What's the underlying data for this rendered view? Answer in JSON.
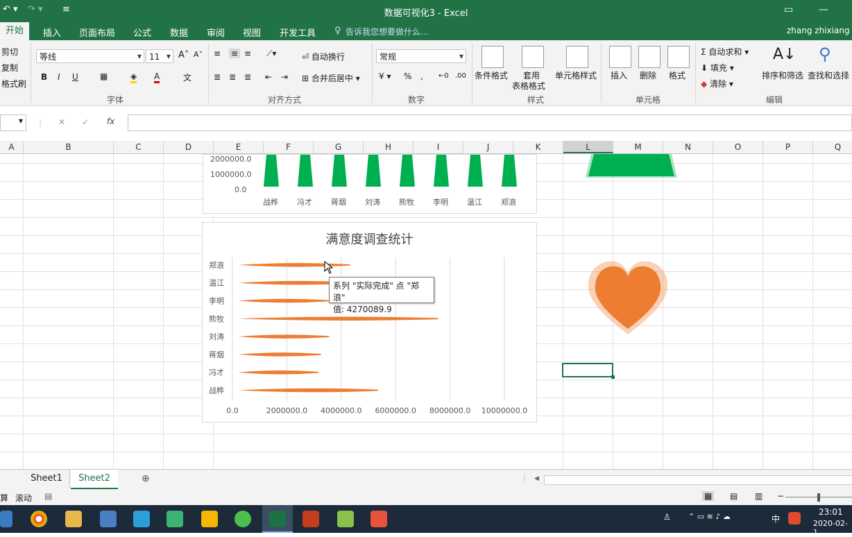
{
  "window": {
    "title": "数据可视化3 - Excel",
    "user": "zhang zhixiang"
  },
  "tabs": [
    "开始",
    "插入",
    "页面布局",
    "公式",
    "数据",
    "审阅",
    "视图",
    "开发工具"
  ],
  "tell_me": "告诉我您想要做什么...",
  "ribbon": {
    "clipboard": {
      "cut": "剪切",
      "copy": "复制",
      "painter": "格式刷"
    },
    "font": {
      "name": "等线",
      "size": "11",
      "group": "字体",
      "bold": "B",
      "italic": "I",
      "underline": "U"
    },
    "align": {
      "wrap": "自动换行",
      "merge": "合并后居中",
      "group": "对齐方式"
    },
    "number": {
      "format": "常规",
      "group": "数字"
    },
    "styles": {
      "cond": "条件格式",
      "table1": "套用",
      "table2": "表格格式",
      "cell": "单元格样式",
      "group": "样式"
    },
    "cells": {
      "insert": "插入",
      "delete": "删除",
      "format": "格式",
      "group": "单元格"
    },
    "edit": {
      "autosum": "自动求和",
      "fill": "填充",
      "clear": "清除",
      "sort": "排序和筛选",
      "find": "查找和选择",
      "group": "编辑"
    }
  },
  "formula_bar": {
    "fx": "fx"
  },
  "columns": [
    "A",
    "B",
    "C",
    "D",
    "E",
    "F",
    "G",
    "H",
    "I",
    "J",
    "K",
    "L",
    "M",
    "N",
    "O",
    "P",
    "Q"
  ],
  "selected_column": "L",
  "chart1": {
    "yticks": [
      "2000000.0",
      "1000000.0",
      "0.0"
    ],
    "categories": [
      "战桦",
      "冯才",
      "蒋烟",
      "刘涛",
      "熊牧",
      "李明",
      "温江",
      "郑浪"
    ]
  },
  "chart_data": {
    "type": "bar",
    "title": "满意度调查统计",
    "categories": [
      "郑浪",
      "温江",
      "李明",
      "熊牧",
      "刘涛",
      "蒋烟",
      "冯才",
      "战桦"
    ],
    "series": [
      {
        "name": "实际完成",
        "values": [
          4270089.9,
          4300000,
          3500000,
          7500000,
          3500000,
          3200000,
          3100000,
          5300000
        ]
      }
    ],
    "xlim": [
      0,
      10000000
    ],
    "xticks": [
      "0.0",
      "2000000.0",
      "4000000.0",
      "6000000.0",
      "8000000.0",
      "10000000.0"
    ],
    "color": "#ED7D31"
  },
  "tooltip": {
    "line1": "系列 \"实际完成\" 点 \"郑浪\"",
    "line2": "值: 4270089.9"
  },
  "sheets": [
    "Sheet1",
    "Sheet2"
  ],
  "active_sheet": "Sheet2",
  "status": {
    "left1": "算",
    "left2": "滚动"
  },
  "taskbar": {
    "time": "23:01",
    "date": "2020-02-1",
    "ime": "中"
  }
}
